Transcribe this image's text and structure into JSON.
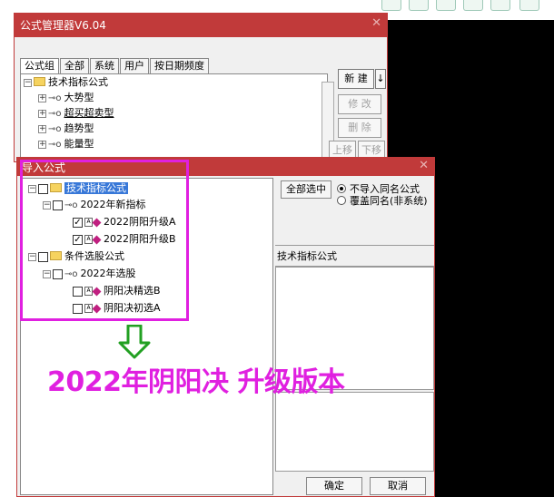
{
  "manager": {
    "title": "公式管理器V6.04",
    "tabs": [
      "公式组",
      "全部",
      "系统",
      "用户",
      "按日期频度"
    ],
    "tree": [
      {
        "label": "技术指标公式",
        "level": 0,
        "type": "folder"
      },
      {
        "label": "大势型",
        "level": 1,
        "type": "key"
      },
      {
        "label": "超买超卖型",
        "level": 1,
        "type": "key"
      },
      {
        "label": "趋势型",
        "level": 1,
        "type": "key"
      },
      {
        "label": "能量型",
        "level": 1,
        "type": "key"
      }
    ],
    "buttons": {
      "new": "新 建",
      "modify": "修 改",
      "delete": "删 除",
      "up": "上移",
      "down": "下移"
    }
  },
  "import_dialog": {
    "title": "导入公式",
    "tree": [
      {
        "label": "技术指标公式",
        "level": 0,
        "type": "folder",
        "checked": false,
        "selected": true
      },
      {
        "label": "2022年新指标",
        "level": 1,
        "type": "key",
        "checked": false
      },
      {
        "label": "2022阴阳升级A",
        "level": 2,
        "type": "formula",
        "checked": true
      },
      {
        "label": "2022阴阳升级B",
        "level": 2,
        "type": "formula",
        "checked": true
      },
      {
        "label": "条件选股公式",
        "level": 0,
        "type": "folder",
        "checked": false
      },
      {
        "label": "2022年选股",
        "level": 1,
        "type": "key",
        "checked": false
      },
      {
        "label": "阴阳决精选B",
        "level": 2,
        "type": "formula",
        "checked": false
      },
      {
        "label": "阴阳决初选A",
        "level": 2,
        "type": "formula",
        "checked": false
      }
    ],
    "select_all": "全部选中",
    "radio_options": [
      {
        "label": "不导入同名公式",
        "selected": true
      },
      {
        "label": "覆盖同名(非系统)",
        "selected": false
      }
    ],
    "category_label": "技术指标公式",
    "ok": "确定",
    "cancel": "取消"
  },
  "overlay": {
    "banner": "2022年阴阳决 升级版本",
    "highlight_color": "#e020e0",
    "arrow_color": "#22a022"
  },
  "colors": {
    "title_bar": "#c13a3a",
    "selection": "#3878d8"
  }
}
